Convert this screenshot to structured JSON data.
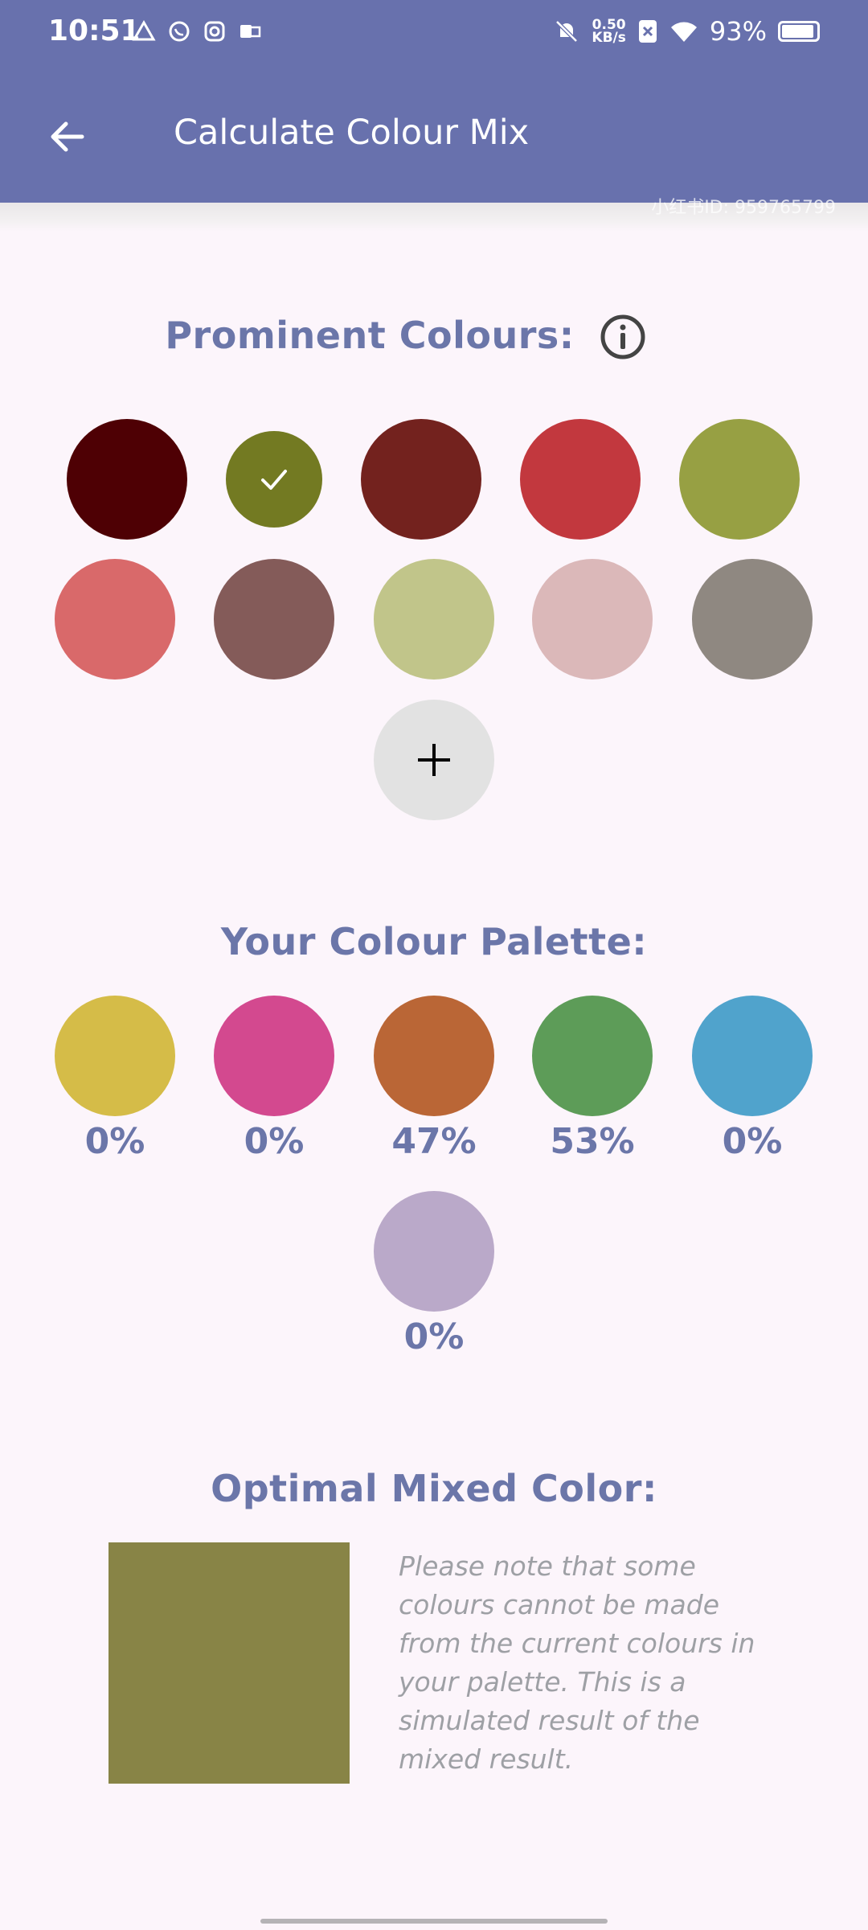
{
  "status_bar": {
    "time": "10:51",
    "net_speed_value": "0.50",
    "net_speed_unit": "KB/s",
    "battery": "93%",
    "battery_level": 0.93
  },
  "app_bar": {
    "title": "Calculate Colour Mix",
    "back_icon": "arrow-left-icon"
  },
  "watermark": "小红书ID: 959765799",
  "prominent": {
    "title": "Prominent Colours:",
    "info_icon": "info-icon",
    "colors": [
      "#4e0004",
      "#737a22",
      "#73221e",
      "#c2383e",
      "#97a043",
      "#d9696a",
      "#845b59",
      "#c1c58a",
      "#dbb8b9",
      "#8f8881"
    ],
    "selected_index": 1,
    "add_icon": "plus-icon"
  },
  "palette": {
    "title": "Your Colour Palette:",
    "items": [
      {
        "color": "#d5bc48",
        "percent": "0%"
      },
      {
        "color": "#d3498f",
        "percent": "0%"
      },
      {
        "color": "#ba6636",
        "percent": "47%"
      },
      {
        "color": "#5d9c58",
        "percent": "53%"
      },
      {
        "color": "#50a3cc",
        "percent": "0%"
      },
      {
        "color": "#baa9c9",
        "percent": "0%"
      }
    ]
  },
  "mixed": {
    "title": "Optimal Mixed Color:",
    "color": "#888446",
    "note": "Please note that some colours cannot be made from the current colours in your palette. This is a simulated result of the mixed result."
  },
  "theme": {
    "primary": "#6871ad",
    "accent_text": "#6b76a9",
    "background": "#fcf5fb"
  }
}
